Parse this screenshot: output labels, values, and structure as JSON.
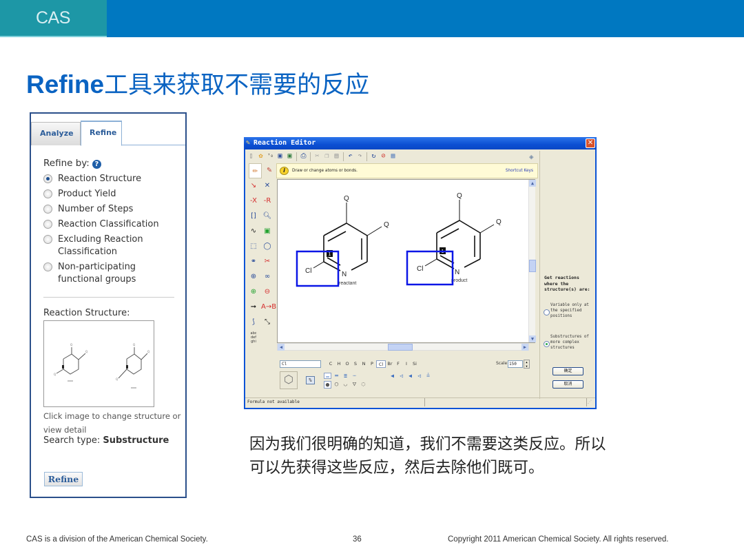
{
  "header": {
    "logo": "CAS",
    "colors": {
      "band_left": "#1d97a6",
      "band_right": "#0078c1",
      "title": "#0a63c2"
    }
  },
  "title": {
    "latin": "Refine",
    "chinese": "工具来获取不需要的反应"
  },
  "panel": {
    "tabs": [
      {
        "label": "Analyze",
        "active": false
      },
      {
        "label": "Refine",
        "active": true
      }
    ],
    "refine_by_label": "Refine by:",
    "help_icon": "?",
    "options": [
      {
        "label": "Reaction Structure",
        "selected": true
      },
      {
        "label": "Product Yield",
        "selected": false
      },
      {
        "label": "Number of Steps",
        "selected": false
      },
      {
        "label": "Reaction Classification",
        "selected": false
      },
      {
        "label": "Excluding Reaction Classification",
        "selected": false
      },
      {
        "label": "Non-participating functional groups",
        "selected": false
      }
    ],
    "reaction_structure_label": "Reaction Structure:",
    "click_note": "Click image to change structure or view detail",
    "search_type_label": "Search type:",
    "search_type_value": "Substructure",
    "refine_button": "Refine"
  },
  "editor": {
    "title": "Reaction Editor",
    "close": "✕",
    "toolbar_icons": [
      "new-icon",
      "open-template-icon",
      "text-atom-icon",
      "save-icon",
      "save-as-image-icon",
      "print-icon",
      "cut-icon",
      "copy-icon",
      "paste-icon",
      "undo-icon",
      "redo-icon",
      "refresh-icon",
      "clear-icon",
      "calculator-icon"
    ],
    "hint": "Draw or change atoms or bonds.",
    "shortcut_keys": "Shortcut Keys",
    "canvas": {
      "reactant_label": "reactant",
      "product_label": "product",
      "atoms": {
        "q": "Q",
        "cl": "Cl",
        "n": "N"
      },
      "map_number": "1"
    },
    "side": {
      "get_label": "Get reactions where the structure(s) are:",
      "options": [
        {
          "label": "Variable only at the specified positions",
          "selected": false
        },
        {
          "label": "Substructures of more complex structures",
          "selected": true
        }
      ],
      "ok_button": "确定",
      "cancel_button": "取消"
    },
    "formula_value": "Cl",
    "elements": [
      "C",
      "H",
      "O",
      "S",
      "N",
      "P",
      "Cl",
      "Br",
      "F",
      "I",
      "Si"
    ],
    "selected_element": "Cl",
    "scale_label": "Scale",
    "scale_value": "150",
    "status": "Formula not available"
  },
  "paragraph": {
    "line1": "因为我们很明确的知道，我们不需要这类反应。所以",
    "line2": "可以先获得这些反应，然后去除他们既可。"
  },
  "footer": {
    "left": "CAS is a division of the American Chemical Society.",
    "page": "36",
    "right": "Copyright 2011 American Chemical Society. All rights reserved."
  }
}
